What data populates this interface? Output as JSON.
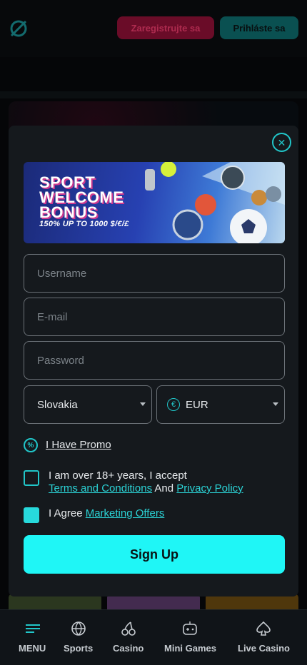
{
  "header": {
    "register_label": "Zaregistrujte sa",
    "login_label": "Prihláste sa"
  },
  "banner": {
    "title_line1": "SPORT",
    "title_line2": "WELCOME",
    "title_line3": "BONUS",
    "subtitle": "150% UP TO 1000 $/€/£"
  },
  "form": {
    "username_placeholder": "Username",
    "email_placeholder": "E-mail",
    "password_placeholder": "Password",
    "country_value": "Slovakia",
    "currency_value": "EUR",
    "currency_symbol": "€",
    "promo_label": "I Have Promo",
    "age_text": "I am over 18+ years, I accept",
    "terms_link": "Terms and Conditions",
    "and_text": "And",
    "privacy_link": "Privacy Policy",
    "agree_text": "I Agree",
    "marketing_link": "Marketing Offers",
    "signup_label": "Sign Up",
    "age_checked": false,
    "marketing_checked": true
  },
  "bottom_nav": {
    "items": [
      {
        "label": "MENU",
        "icon": "menu-icon"
      },
      {
        "label": "Sports",
        "icon": "basketball-icon"
      },
      {
        "label": "Casino",
        "icon": "cherries-icon"
      },
      {
        "label": "Mini Games",
        "icon": "gamepad-icon"
      },
      {
        "label": "Live Casino",
        "icon": "spade-icon"
      }
    ]
  },
  "colors": {
    "accent": "#1ff6f6",
    "link": "#2bd3d6",
    "register_bg": "#8e1036",
    "login_bg": "#0e6b6d",
    "modal_bg": "#15191d"
  }
}
